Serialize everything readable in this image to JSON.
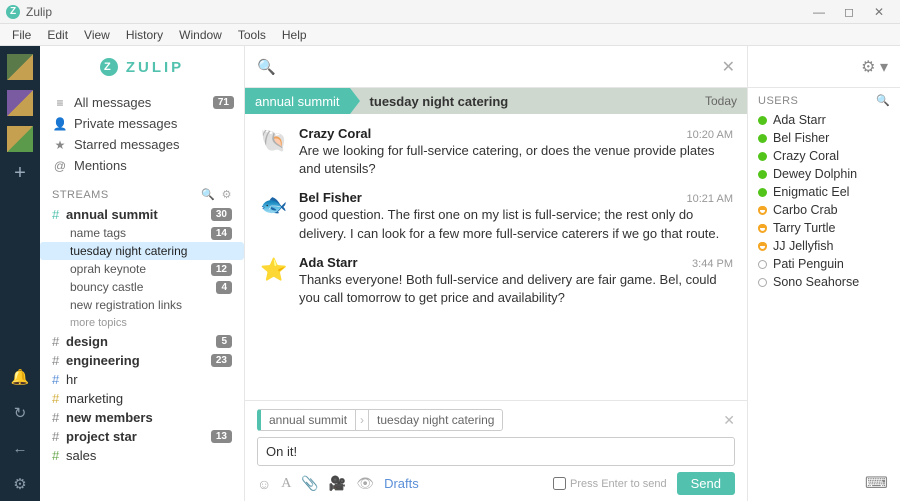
{
  "window": {
    "title": "Zulip"
  },
  "menubar": [
    "File",
    "Edit",
    "View",
    "History",
    "Window",
    "Tools",
    "Help"
  ],
  "brand": "ZULIP",
  "nav": [
    {
      "icon": "align",
      "label": "All messages",
      "badge": "71"
    },
    {
      "icon": "user",
      "label": "Private messages"
    },
    {
      "icon": "star",
      "label": "Starred messages"
    },
    {
      "icon": "at",
      "label": "Mentions"
    }
  ],
  "streams_label": "STREAMS",
  "streams": [
    {
      "name": "annual summit",
      "color": "teal",
      "bold": true,
      "badge": "30",
      "topics": [
        {
          "name": "name tags",
          "badge": "14"
        },
        {
          "name": "tuesday night catering",
          "selected": true
        },
        {
          "name": "oprah keynote",
          "badge": "12"
        },
        {
          "name": "bouncy castle",
          "badge": "4"
        },
        {
          "name": "new registration links"
        }
      ],
      "more": "more topics"
    },
    {
      "name": "design",
      "color": "",
      "bold": true,
      "badge": "5"
    },
    {
      "name": "engineering",
      "color": "",
      "bold": true,
      "badge": "23"
    },
    {
      "name": "hr",
      "color": "blue"
    },
    {
      "name": "marketing",
      "color": "yellow"
    },
    {
      "name": "new members",
      "color": "",
      "bold": true
    },
    {
      "name": "project star",
      "color": "",
      "bold": true,
      "badge": "13"
    },
    {
      "name": "sales",
      "color": "green"
    }
  ],
  "thread": {
    "stream": "annual summit",
    "topic": "tuesday night catering",
    "date": "Today"
  },
  "messages": [
    {
      "sender": "Crazy Coral",
      "time": "10:20 AM",
      "avatar_color": "#8a4a9a",
      "text": "Are we looking for full-service catering, or does the venue provide plates and utensils?"
    },
    {
      "sender": "Bel Fisher",
      "time": "10:21 AM",
      "avatar_color": "#6aa84f",
      "text": "good question. The first one on my list is full-service; the rest only do delivery. I can look for a few more full-service caterers if we go that route."
    },
    {
      "sender": "Ada Starr",
      "time": "3:44 PM",
      "avatar_color": "#d48a5a",
      "text": "Thanks everyone! Both full-service and delivery are fair game. Bel, could you call tomorrow to get price and availability?"
    }
  ],
  "compose": {
    "stream": "annual summit",
    "topic": "tuesday night catering",
    "body": "On it!",
    "drafts": "Drafts",
    "press_enter": "Press Enter to send",
    "send": "Send"
  },
  "users_label": "USERS",
  "users": [
    {
      "name": "Ada Starr",
      "status": "online"
    },
    {
      "name": "Bel Fisher",
      "status": "online"
    },
    {
      "name": "Crazy Coral",
      "status": "online"
    },
    {
      "name": "Dewey Dolphin",
      "status": "online"
    },
    {
      "name": "Enigmatic Eel",
      "status": "online"
    },
    {
      "name": "Carbo Crab",
      "status": "idle"
    },
    {
      "name": "Tarry Turtle",
      "status": "idle"
    },
    {
      "name": "JJ Jellyfish",
      "status": "idle"
    },
    {
      "name": "Pati Penguin",
      "status": "offline"
    },
    {
      "name": "Sono Seahorse",
      "status": "offline"
    }
  ]
}
